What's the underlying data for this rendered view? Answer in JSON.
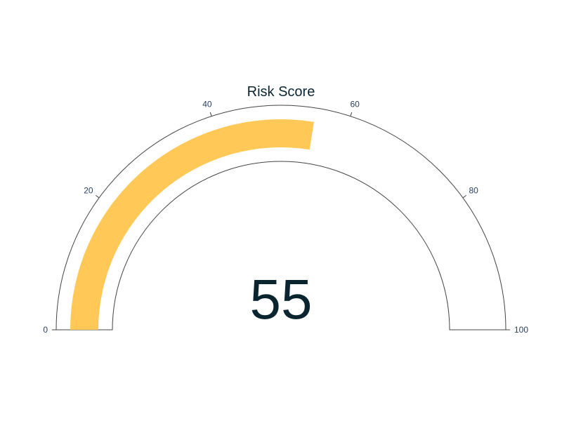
{
  "chart_data": {
    "type": "gauge",
    "title": "Risk Score",
    "value": 55,
    "value_label": "55",
    "range": [
      0,
      100
    ],
    "ticks": [
      {
        "value": 0,
        "label": "0"
      },
      {
        "value": 20,
        "label": "20"
      },
      {
        "value": 40,
        "label": "40"
      },
      {
        "value": 60,
        "label": "60"
      },
      {
        "value": 80,
        "label": "80"
      },
      {
        "value": 100,
        "label": "100"
      }
    ],
    "colors": {
      "bar": "#FFC857",
      "outline": "#444444",
      "text": "#0B2530",
      "tick_text": "#2a3f5f"
    }
  }
}
